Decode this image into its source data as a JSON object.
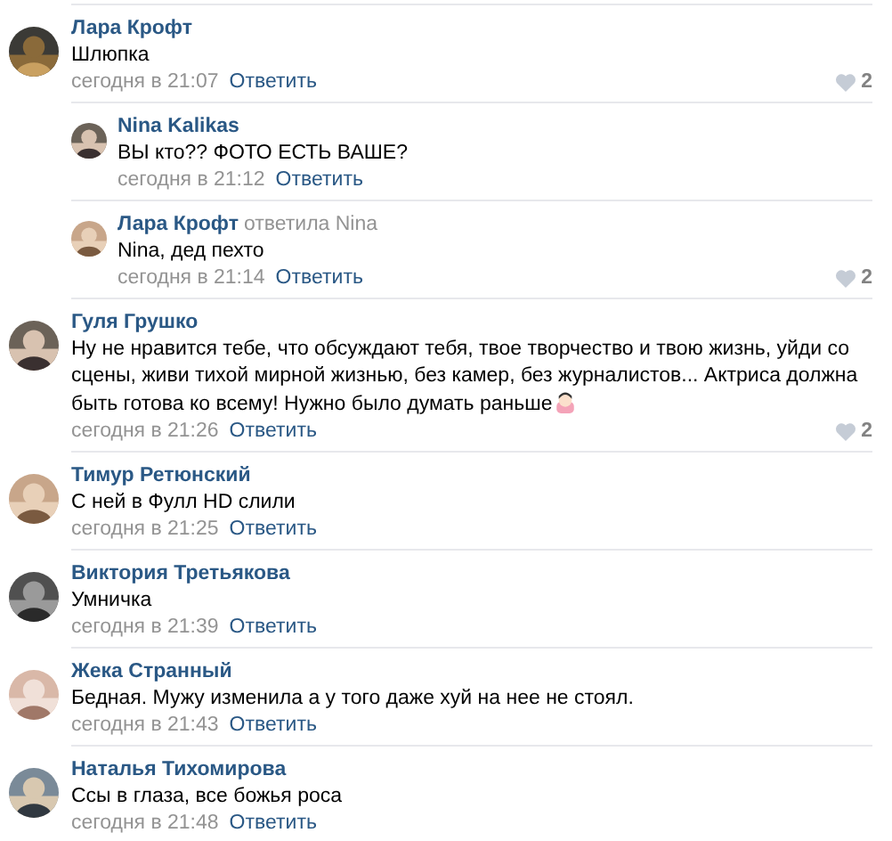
{
  "comments": [
    {
      "author": "Лара Крофт",
      "text": "Шлюпка",
      "time": "сегодня в 21:07",
      "reply": "Ответить",
      "likes": "2",
      "children": [
        {
          "author": "Nina Kalikas",
          "text": "ВЫ кто?? ФОТО ЕСТЬ ВАШЕ?",
          "time": "сегодня в 21:12",
          "reply": "Ответить"
        },
        {
          "author": "Лара Крофт",
          "reply_to": "ответила Nina",
          "text": "Nina, дед пехто",
          "time": "сегодня в 21:14",
          "reply": "Ответить",
          "likes": "2"
        }
      ]
    },
    {
      "author": "Гуля Грушко",
      "text": "Ну не нравится тебе, что обсуждают тебя, твое творчество и твою жизнь, уйди со сцены, живи тихой мирной жизнью, без камер, без журналистов... Актриса должна быть готова ко всему! Нужно было думать раньше",
      "emoji": true,
      "time": "сегодня в 21:26",
      "reply": "Ответить",
      "likes": "2"
    },
    {
      "author": "Тимур Ретюнский",
      "text": "С ней в Фулл HD слили",
      "time": "сегодня в 21:25",
      "reply": "Ответить"
    },
    {
      "author": "Виктория Третьякова",
      "text": "Умничка",
      "time": "сегодня в 21:39",
      "reply": "Ответить"
    },
    {
      "author": "Жека Странный",
      "text": "Бедная. Мужу изменила а у того даже хуй на нее не стоял.",
      "time": "сегодня в 21:43",
      "reply": "Ответить"
    },
    {
      "author": "Наталья Тихомирова",
      "text": "Ссы в глаза, все божья роса",
      "time": "сегодня в 21:48",
      "reply": "Ответить"
    }
  ]
}
